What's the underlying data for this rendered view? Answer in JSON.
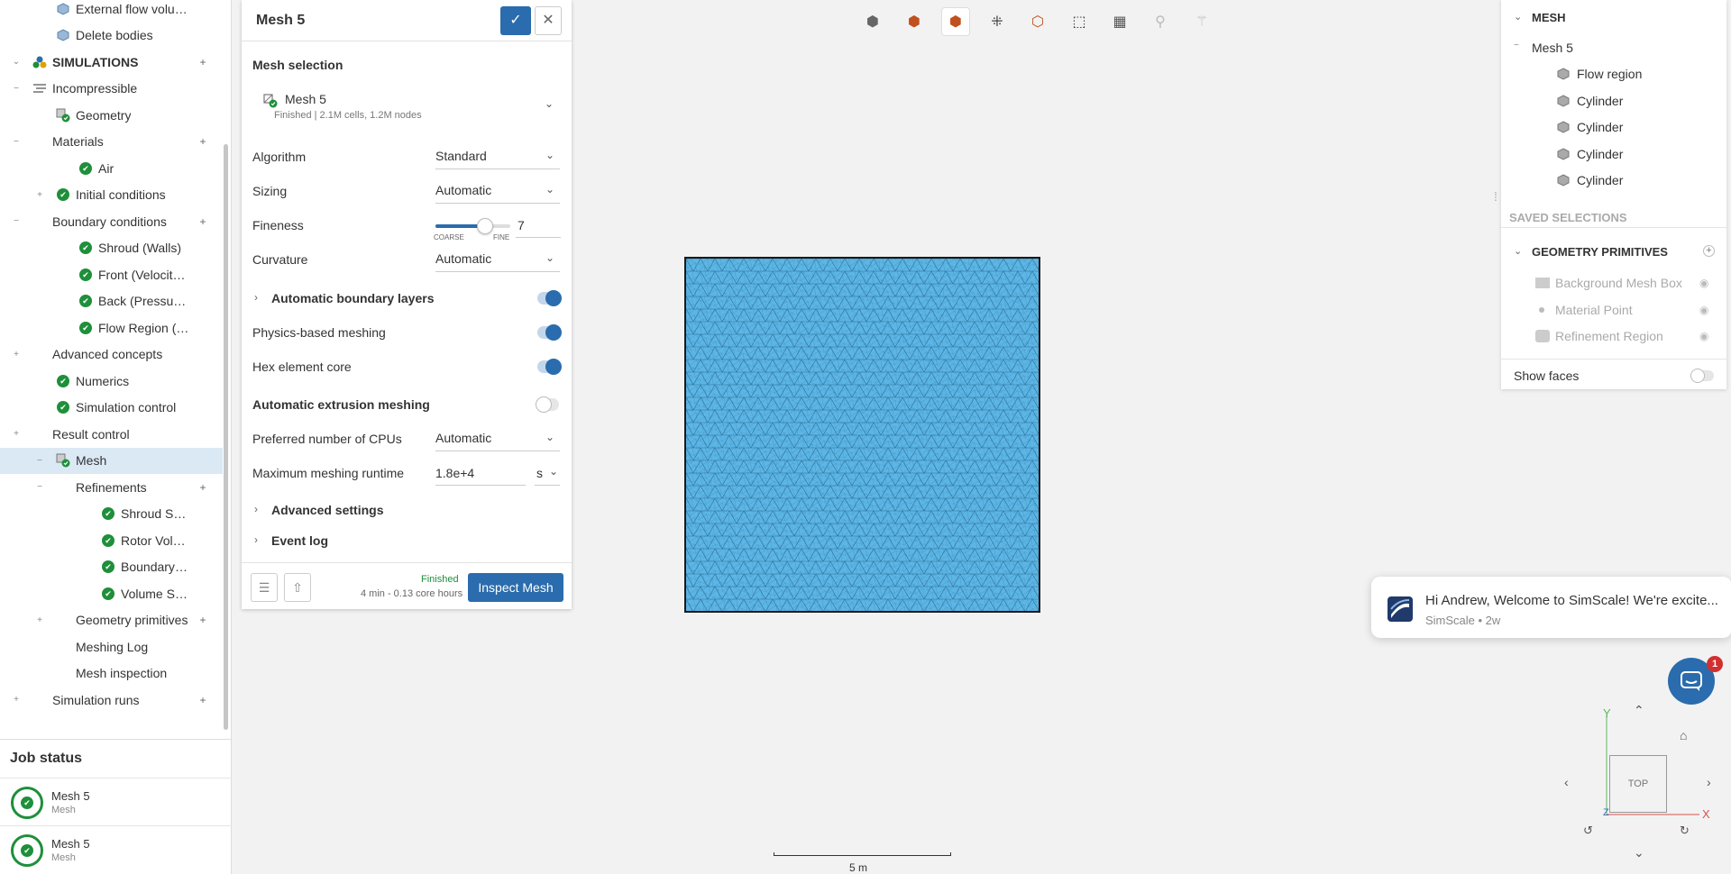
{
  "tree": {
    "items": [
      {
        "label": "External flow volume",
        "bold": false,
        "indent": 2,
        "icon": "cube-icon",
        "toggle": ""
      },
      {
        "label": "Delete bodies",
        "bold": false,
        "indent": 2,
        "icon": "cube-icon",
        "toggle": ""
      },
      {
        "label": "SIMULATIONS",
        "bold": true,
        "indent": 1,
        "icon": "simulations-icon",
        "toggle": "⌄",
        "plus": true
      },
      {
        "label": "Incompressible",
        "bold": false,
        "indent": 1,
        "icon": "list-icon",
        "toggle": "−"
      },
      {
        "label": "Geometry",
        "bold": false,
        "indent": 2,
        "icon": "geometry-icon",
        "toggle": ""
      },
      {
        "label": "Materials",
        "bold": false,
        "indent": 1,
        "icon": "",
        "toggle": "−",
        "plus": true
      },
      {
        "label": "Air",
        "bold": false,
        "indent": 3,
        "icon": "check-icon",
        "toggle": ""
      },
      {
        "label": "Initial conditions",
        "bold": false,
        "indent": 2,
        "icon": "check-icon",
        "toggle": "+"
      },
      {
        "label": "Boundary conditions",
        "bold": false,
        "indent": 1,
        "icon": "",
        "toggle": "−",
        "plus": true
      },
      {
        "label": "Shroud (Walls)",
        "bold": false,
        "indent": 3,
        "icon": "check-icon",
        "toggle": ""
      },
      {
        "label": "Front (Velocity Inlet)",
        "bold": false,
        "indent": 3,
        "icon": "check-icon",
        "toggle": ""
      },
      {
        "label": "Back (Pressure Ou...",
        "bold": false,
        "indent": 3,
        "icon": "check-icon",
        "toggle": ""
      },
      {
        "label": "Flow Region (Walls)",
        "bold": false,
        "indent": 3,
        "icon": "check-icon",
        "toggle": ""
      },
      {
        "label": "Advanced concepts",
        "bold": false,
        "indent": 1,
        "icon": "",
        "toggle": "+"
      },
      {
        "label": "Numerics",
        "bold": false,
        "indent": 2,
        "icon": "check-icon",
        "toggle": ""
      },
      {
        "label": "Simulation control",
        "bold": false,
        "indent": 2,
        "icon": "check-icon",
        "toggle": ""
      },
      {
        "label": "Result control",
        "bold": false,
        "indent": 1,
        "icon": "",
        "toggle": "+"
      },
      {
        "label": "Mesh",
        "bold": false,
        "indent": 2,
        "icon": "mesh-icon",
        "toggle": "−",
        "selected": true
      },
      {
        "label": "Refinements",
        "bold": false,
        "indent": 2,
        "icon": "",
        "toggle": "−",
        "plus": true
      },
      {
        "label": "Shroud Surfac...",
        "bold": false,
        "indent": 4,
        "icon": "check-icon",
        "toggle": ""
      },
      {
        "label": "Rotor Volume ...",
        "bold": false,
        "indent": 4,
        "icon": "check-icon",
        "toggle": ""
      },
      {
        "label": "Boundary Refi...",
        "bold": false,
        "indent": 4,
        "icon": "check-icon",
        "toggle": ""
      },
      {
        "label": "Volume Sizing",
        "bold": false,
        "indent": 4,
        "icon": "check-icon",
        "toggle": ""
      },
      {
        "label": "Geometry primitives",
        "bold": false,
        "indent": 2,
        "icon": "",
        "toggle": "+",
        "plus": true
      },
      {
        "label": "Meshing Log",
        "bold": false,
        "indent": 2,
        "icon": "",
        "toggle": ""
      },
      {
        "label": "Mesh inspection",
        "bold": false,
        "indent": 2,
        "icon": "",
        "toggle": ""
      },
      {
        "label": "Simulation runs",
        "bold": false,
        "indent": 1,
        "icon": "",
        "toggle": "+",
        "plus": true
      }
    ]
  },
  "jobs": {
    "title": "Job status",
    "items": [
      {
        "name": "Mesh 5",
        "type": "Mesh"
      },
      {
        "name": "Mesh 5",
        "type": "Mesh"
      }
    ]
  },
  "editor": {
    "title": "Mesh 5",
    "mesh_selection_label": "Mesh selection",
    "mesh_name": "Mesh 5",
    "mesh_status": "Finished | 2.1M cells, 1.2M nodes",
    "algorithm_label": "Algorithm",
    "algorithm_value": "Standard",
    "sizing_label": "Sizing",
    "sizing_value": "Automatic",
    "fineness_label": "Fineness",
    "fineness_value": "7",
    "fineness_fraction": 0.667,
    "coarse_label": "COARSE",
    "fine_label": "FINE",
    "curvature_label": "Curvature",
    "curvature_value": "Automatic",
    "auto_boundary_label": "Automatic boundary layers",
    "physics_label": "Physics-based meshing",
    "hex_label": "Hex element core",
    "extrusion_label": "Automatic extrusion meshing",
    "cpus_label": "Preferred number of CPUs",
    "cpus_value": "Automatic",
    "runtime_label": "Maximum meshing runtime",
    "runtime_value": "1.8e+4",
    "runtime_unit": "s",
    "advanced_label": "Advanced settings",
    "eventlog_label": "Event log",
    "footer_status": "Finished",
    "footer_time": "4 min - 0.13 core hours",
    "inspect_label": "Inspect Mesh"
  },
  "viewport": {
    "scale_label": "5 m",
    "mesh_color": "#5bb6e6"
  },
  "right_panel": {
    "mesh_header": "MESH",
    "mesh_name": "Mesh 5",
    "parts": [
      "Flow region",
      "Cylinder",
      "Cylinder",
      "Cylinder",
      "Cylinder"
    ],
    "saved_selections": "SAVED SELECTIONS",
    "geometry_primitives": "GEOMETRY PRIMITIVES",
    "primitives": [
      "Background Mesh Box",
      "Material Point",
      "Refinement Region"
    ],
    "show_faces": "Show faces"
  },
  "notification": {
    "message": "Hi Andrew, Welcome to SimScale! We're excite...",
    "meta": "SimScale • 2w"
  },
  "chat_badge": "1",
  "navcube": {
    "face": "TOP",
    "x": "X",
    "y": "Y",
    "z": "Z"
  },
  "colors": {
    "accent": "#2a6cad",
    "success": "#1e8f3a",
    "mesh_fill": "#5bb6e6"
  }
}
